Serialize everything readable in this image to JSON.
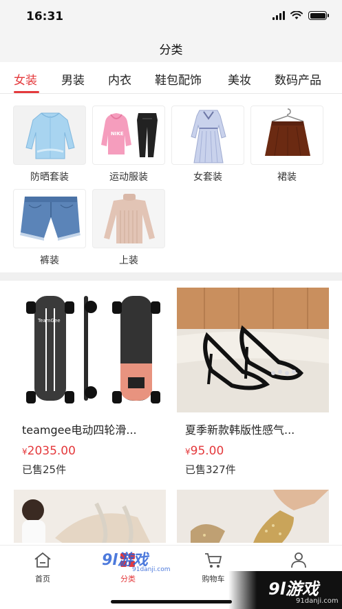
{
  "status_bar": {
    "time": "16:31"
  },
  "nav": {
    "title": "分类"
  },
  "tabs": [
    {
      "label": "女装",
      "active": true
    },
    {
      "label": "男装",
      "active": false
    },
    {
      "label": "内衣",
      "active": false
    },
    {
      "label": "鞋包配饰",
      "active": false
    },
    {
      "label": "美妆",
      "active": false
    },
    {
      "label": "数码产品",
      "active": false
    }
  ],
  "subcategories": [
    {
      "label": "防晒套装",
      "icon": "sun-protection-jacket"
    },
    {
      "label": "运动服装",
      "icon": "hoodie-and-joggers"
    },
    {
      "label": "女套装",
      "icon": "striped-dress"
    },
    {
      "label": "裙装",
      "icon": "brown-skirt-on-hanger"
    },
    {
      "label": "裤装",
      "icon": "denim-shorts"
    },
    {
      "label": "上装",
      "icon": "knit-sweater"
    }
  ],
  "products": [
    {
      "title": "teamgee电动四轮滑...",
      "currency": "¥",
      "price": "2035.00",
      "sold": "已售25件",
      "image": "electric-skateboard"
    },
    {
      "title": "夏季新款韩版性感气...",
      "currency": "¥",
      "price": "95.00",
      "sold": "已售327件",
      "image": "black-heeled-sandals"
    },
    {
      "title": "",
      "currency": "",
      "price": "",
      "sold": "",
      "image": "clear-strap-sandals"
    },
    {
      "title": "",
      "currency": "",
      "price": "",
      "sold": "",
      "image": "glitter-heels"
    }
  ],
  "tabbar": [
    {
      "label": "首页",
      "icon": "home-icon",
      "active": false
    },
    {
      "label": "分类",
      "icon": "category-icon",
      "active": true
    },
    {
      "label": "购物车",
      "icon": "cart-icon",
      "active": false
    },
    {
      "label": "",
      "icon": "user-icon",
      "active": false
    }
  ],
  "watermarks": {
    "center_main": "9l游戏",
    "center_sub": "91danji.com",
    "corner_main": "9l游戏",
    "corner_sub": "91danji.com"
  },
  "colors": {
    "accent": "#e4393c",
    "nav_bg": "#f4f4f4",
    "divider": "#f0f0f0"
  }
}
